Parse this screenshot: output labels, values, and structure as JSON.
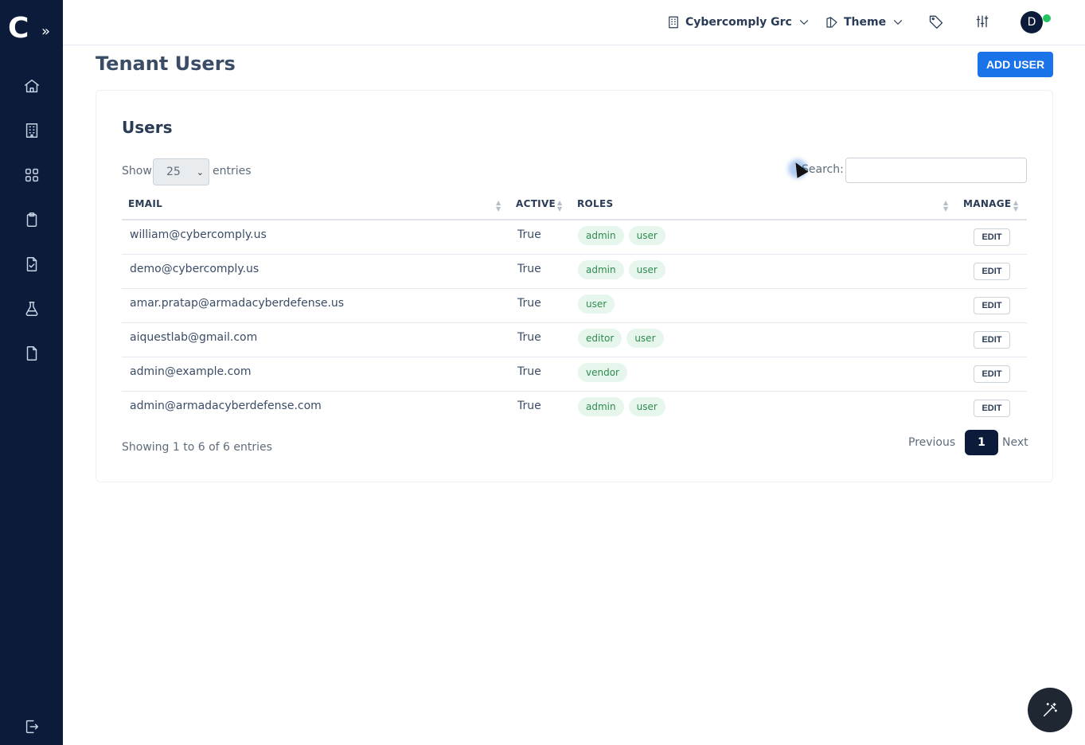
{
  "sidebar": {
    "logo": "C",
    "expand": "»",
    "icons": [
      "home-icon",
      "building-icon",
      "grid-icon",
      "clipboard-icon",
      "file-check-icon",
      "flask-icon",
      "file-icon",
      "logout-icon"
    ]
  },
  "topbar": {
    "tenant": "Cybercomply Grc",
    "theme": "Theme",
    "avatar": "D"
  },
  "page": {
    "title": "Tenant Users",
    "add_user": "ADD USER"
  },
  "card": {
    "title": "Users",
    "show_label": "Show",
    "entries_value": "25",
    "entries_label": "entries",
    "search_label": "Search:",
    "search_value": ""
  },
  "table": {
    "headers": {
      "email": "EMAIL",
      "active": "ACTIVE",
      "roles": "ROLES",
      "manage": "MANAGE"
    },
    "rows": [
      {
        "email": "william@cybercomply.us",
        "active": "True",
        "roles": [
          "admin",
          "user"
        ],
        "action": "EDIT"
      },
      {
        "email": "demo@cybercomply.us",
        "active": "True",
        "roles": [
          "admin",
          "user"
        ],
        "action": "EDIT"
      },
      {
        "email": "amar.pratap@armadacyberdefense.us",
        "active": "True",
        "roles": [
          "user"
        ],
        "action": "EDIT"
      },
      {
        "email": "aiquestlab@gmail.com",
        "active": "True",
        "roles": [
          "editor",
          "user"
        ],
        "action": "EDIT"
      },
      {
        "email": "admin@example.com",
        "active": "True",
        "roles": [
          "vendor"
        ],
        "action": "EDIT"
      },
      {
        "email": "admin@armadacyberdefense.com",
        "active": "True",
        "roles": [
          "admin",
          "user"
        ],
        "action": "EDIT"
      }
    ]
  },
  "pagination": {
    "info": "Showing 1 to 6 of 6 entries",
    "previous": "Previous",
    "current": "1",
    "next": "Next"
  },
  "colors": {
    "sidebar": "#0c1b3a",
    "accent": "#1a73e8",
    "role_bg": "#e7f6ec",
    "role_text": "#2e8b4f",
    "online": "#22c55e"
  }
}
